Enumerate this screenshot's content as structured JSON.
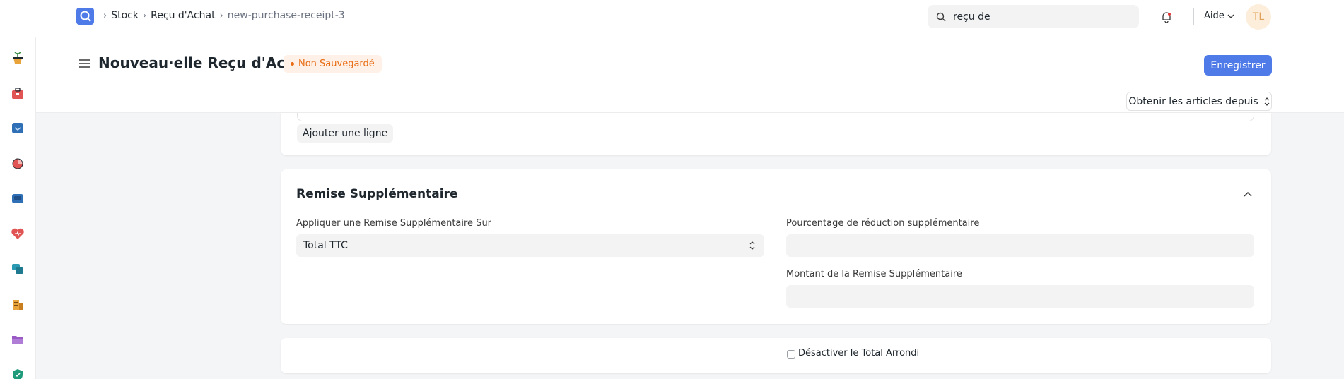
{
  "navbar": {
    "breadcrumbs": [
      "Stock",
      "Reçu d'Achat",
      "new-purchase-receipt-3"
    ],
    "search_value": "reçu de",
    "help_label": "Aide",
    "avatar_initials": "TL"
  },
  "sidebar": {
    "icons": [
      "pot-plant-icon",
      "toolbox-icon",
      "inbox-icon",
      "pie-chart-icon",
      "tray-icon",
      "heart-icon",
      "chat-bubbles-icon",
      "building-icon",
      "folder-icon",
      "shield-icon"
    ]
  },
  "page_head": {
    "title": "Nouveau·elle Reçu d'Achat",
    "status": "Non Sauvegardé",
    "save_label": "Enregistrer",
    "get_items_label": "Obtenir les articles depuis"
  },
  "items_section": {
    "add_row_label": "Ajouter une ligne"
  },
  "discount_section": {
    "title": "Remise Supplémentaire",
    "apply_on_label": "Appliquer une Remise Supplémentaire Sur",
    "apply_on_value": "Total TTC",
    "percentage_label": "Pourcentage de réduction supplémentaire",
    "percentage_value": "",
    "amount_label": "Montant de la Remise Supplémentaire",
    "amount_value": ""
  },
  "rounding_section": {
    "disable_rounded_label": "Désactiver le Total Arrondi",
    "disable_rounded_checked": false
  },
  "colors": {
    "primary": "#4f7be8",
    "status_orange": "#e86c13",
    "status_bg": "#fff1e7"
  }
}
